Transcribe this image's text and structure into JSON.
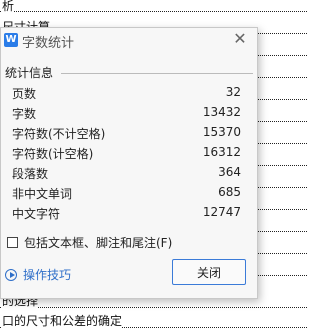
{
  "document": {
    "lines": [
      {
        "text": "析"
      },
      {
        "text": "尺寸计算"
      },
      {
        "text": ""
      },
      {
        "text": ""
      },
      {
        "text": ""
      },
      {
        "text": ""
      },
      {
        "text": ""
      },
      {
        "text": ""
      },
      {
        "text": ""
      },
      {
        "text": ""
      },
      {
        "text": ""
      },
      {
        "text": ""
      },
      {
        "text": ""
      },
      {
        "text": "的选择"
      },
      {
        "text": "口的尺寸和公差的确定"
      }
    ]
  },
  "dialog": {
    "title": "字数统计",
    "app_icon": "wps-writer-icon",
    "close_icon": "close-icon",
    "section_title": "统计信息",
    "stats": [
      {
        "label": "页数",
        "value": "32"
      },
      {
        "label": "字数",
        "value": "13432"
      },
      {
        "label": "字符数(不计空格)",
        "value": "15370"
      },
      {
        "label": "字符数(计空格)",
        "value": "16312"
      },
      {
        "label": "段落数",
        "value": "364"
      },
      {
        "label": "非中文单词",
        "value": "685"
      },
      {
        "label": "中文字符",
        "value": "12747"
      }
    ],
    "checkbox_label": "包括文本框、脚注和尾注(F)",
    "checkbox_checked": false,
    "tips_label": "操作技巧",
    "close_button_label": "关闭"
  },
  "colors": {
    "accent": "#2f6fc9",
    "dialog_bg": "#f7f7f7",
    "button_border": "#3b7bd8"
  }
}
